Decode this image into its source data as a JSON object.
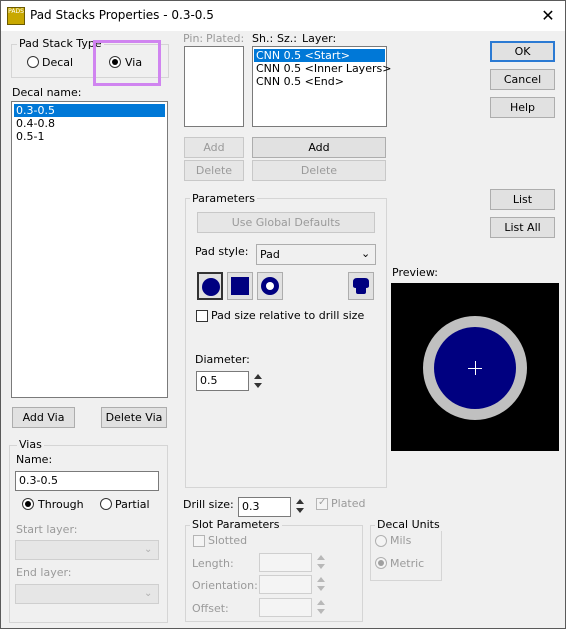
{
  "window": {
    "title": "Pad Stacks Properties - 0.3-0.5",
    "app_icon_text": "PADS"
  },
  "pad_stack_type": {
    "label": "Pad Stack Type",
    "decal": "Decal",
    "via": "Via",
    "selected": "Via"
  },
  "decal_name": {
    "label": "Decal name:",
    "items": [
      "0.3-0.5",
      "0.4-0.8",
      "0.5-1"
    ],
    "selected_index": 0
  },
  "buttons": {
    "add_via": "Add Via",
    "delete_via": "Delete Via",
    "ok": "OK",
    "cancel": "Cancel",
    "help": "Help",
    "list": "List",
    "list_all": "List All"
  },
  "vias": {
    "label": "Vias",
    "name_label": "Name:",
    "name_value": "0.3-0.5",
    "through": "Through",
    "partial": "Partial",
    "selected": "Through",
    "start_layer": "Start layer:",
    "end_layer": "End layer:"
  },
  "pin_panel": {
    "pin_header": "Pin:",
    "plated_header": "Plated:",
    "add": "Add",
    "delete": "Delete"
  },
  "layer_panel": {
    "header_sh": "Sh.:",
    "header_sz": "Sz.:",
    "header_layer": "Layer:",
    "items": [
      "CNN 0.5 <Start>",
      "CNN 0.5 <Inner Layers>",
      "CNN 0.5 <End>"
    ],
    "selected_index": 0,
    "add": "Add",
    "delete": "Delete"
  },
  "parameters": {
    "label": "Parameters",
    "use_global_defaults": "Use Global Defaults",
    "pad_style_label": "Pad style:",
    "pad_style_value": "Pad",
    "relative_checkbox": "Pad size relative to drill size",
    "diameter_label": "Diameter:",
    "diameter_value": "0.5"
  },
  "preview": {
    "label": "Preview:"
  },
  "drill": {
    "label": "Drill size:",
    "value": "0.3",
    "plated": "Plated"
  },
  "slot": {
    "label": "Slot Parameters",
    "slotted": "Slotted",
    "length": "Length:",
    "orientation": "Orientation:",
    "offset": "Offset:"
  },
  "decal_units": {
    "label": "Decal Units",
    "mils": "Mils",
    "metric": "Metric",
    "selected": "Metric"
  },
  "colors": {
    "pad_fill": "#000080",
    "preview_bg": "#000000",
    "preview_ring": "#c0c0c0",
    "highlight": "#d084f0",
    "selection": "#0078d7"
  }
}
